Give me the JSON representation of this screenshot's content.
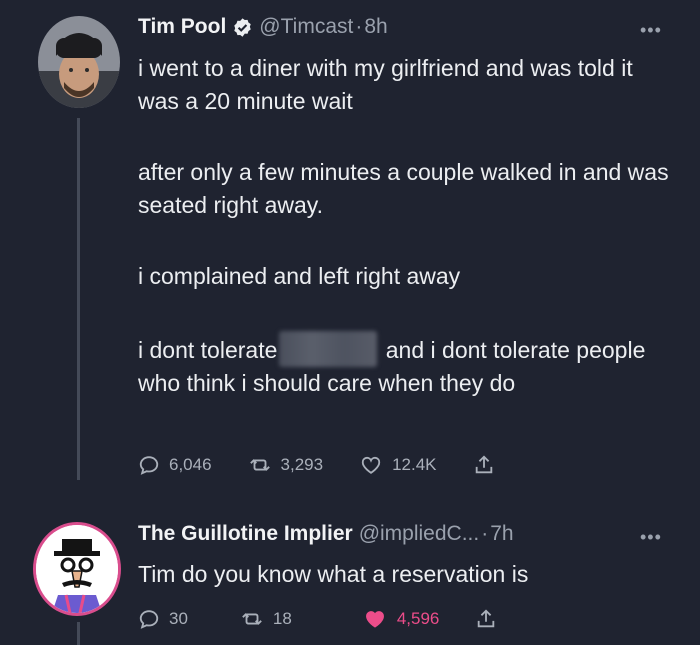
{
  "tweet1": {
    "display_name": "Tim Pool",
    "handle": "@Timcast",
    "separator": "·",
    "time": "8h",
    "more_icon": "more-dots-icon",
    "verified_icon": "verified-badge-icon",
    "paragraphs": [
      "i went to a diner with my girlfriend and was told it was a 20 minute wait",
      "after only a few minutes a couple walked in and was seated right away.",
      "i complained and left right away"
    ],
    "last_paragraph_before": "i dont tolerate",
    "last_paragraph_after": "and i dont tolerate people who think i should care when they do",
    "replies": "6,046",
    "retweets": "3,293",
    "likes": "12.4K"
  },
  "tweet2": {
    "display_name": "The Guillotine Implier",
    "handle": "@impliedC...",
    "separator": "·",
    "time": "7h",
    "text": "Tim do you know what a reservation is",
    "replies": "30",
    "retweets": "18",
    "likes": "4,596",
    "liked": true
  },
  "colors": {
    "background": "#1f2330",
    "secondary_text": "#9aa1ad",
    "like_active": "#ec4d8a",
    "thread_line": "#444a58"
  }
}
